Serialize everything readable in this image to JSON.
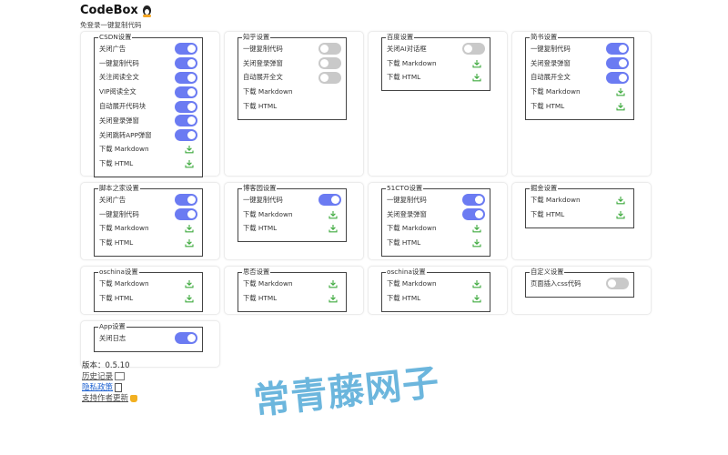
{
  "header": {
    "title": "CodeBox",
    "subtitle": "免登录一键复制代码"
  },
  "cards": [
    {
      "legend": "CSDN设置",
      "rows": [
        {
          "label": "关闭广告",
          "type": "toggle",
          "on": true
        },
        {
          "label": "一键复制代码",
          "type": "toggle",
          "on": true
        },
        {
          "label": "关注阅读全文",
          "type": "toggle",
          "on": true
        },
        {
          "label": "VIP阅读全文",
          "type": "toggle",
          "on": true
        },
        {
          "label": "自动展开代码块",
          "type": "toggle",
          "on": true
        },
        {
          "label": "关闭登录弹窗",
          "type": "toggle",
          "on": true
        },
        {
          "label": "关闭跳转APP弹窗",
          "type": "toggle",
          "on": true
        },
        {
          "label": "下载 Markdown",
          "type": "download"
        },
        {
          "label": "下载 HTML",
          "type": "download"
        }
      ]
    },
    {
      "legend": "知乎设置",
      "rows": [
        {
          "label": "一键复制代码",
          "type": "toggle",
          "on": false
        },
        {
          "label": "关闭登录弹窗",
          "type": "toggle",
          "on": false
        },
        {
          "label": "自动展开全文",
          "type": "toggle",
          "on": false
        },
        {
          "label": "下载 Markdown",
          "type": "text"
        },
        {
          "label": "下载 HTML",
          "type": "text"
        }
      ]
    },
    {
      "legend": "百度设置",
      "rows": [
        {
          "label": "关闭AI对话框",
          "type": "toggle",
          "on": false
        },
        {
          "label": "下载 Markdown",
          "type": "download"
        },
        {
          "label": "下载 HTML",
          "type": "download"
        }
      ]
    },
    {
      "legend": "简书设置",
      "rows": [
        {
          "label": "一键复制代码",
          "type": "toggle",
          "on": true
        },
        {
          "label": "关闭登录弹窗",
          "type": "toggle",
          "on": true
        },
        {
          "label": "自动展开全文",
          "type": "toggle",
          "on": true
        },
        {
          "label": "下载 Markdown",
          "type": "download"
        },
        {
          "label": "下载 HTML",
          "type": "download"
        }
      ]
    },
    {
      "legend": "脚本之家设置",
      "rows": [
        {
          "label": "关闭广告",
          "type": "toggle",
          "on": true
        },
        {
          "label": "一键复制代码",
          "type": "toggle",
          "on": true
        },
        {
          "label": "下载 Markdown",
          "type": "download"
        },
        {
          "label": "下载 HTML",
          "type": "download"
        }
      ]
    },
    {
      "legend": "博客园设置",
      "rows": [
        {
          "label": "一键复制代码",
          "type": "toggle",
          "on": true
        },
        {
          "label": "下载 Markdown",
          "type": "download"
        },
        {
          "label": "下载 HTML",
          "type": "download"
        }
      ]
    },
    {
      "legend": "51CTO设置",
      "rows": [
        {
          "label": "一键复制代码",
          "type": "toggle",
          "on": true
        },
        {
          "label": "关闭登录弹窗",
          "type": "toggle",
          "on": true
        },
        {
          "label": "下载 Markdown",
          "type": "download"
        },
        {
          "label": "下载 HTML",
          "type": "download"
        }
      ]
    },
    {
      "legend": "掘金设置",
      "rows": [
        {
          "label": "下载 Markdown",
          "type": "download"
        },
        {
          "label": "下载 HTML",
          "type": "download"
        }
      ]
    },
    {
      "legend": "oschina设置",
      "rows": [
        {
          "label": "下载 Markdown",
          "type": "download"
        },
        {
          "label": "下载 HTML",
          "type": "download"
        }
      ]
    },
    {
      "legend": "思否设置",
      "rows": [
        {
          "label": "下载 Markdown",
          "type": "download"
        },
        {
          "label": "下载 HTML",
          "type": "download"
        }
      ]
    },
    {
      "legend": "oschina设置",
      "rows": [
        {
          "label": "下载 Markdown",
          "type": "download"
        },
        {
          "label": "下载 HTML",
          "type": "download"
        }
      ]
    },
    {
      "legend": "自定义设置",
      "rows": [
        {
          "label": "页面插入css代码",
          "type": "toggle",
          "on": false
        }
      ]
    },
    {
      "legend": "App设置",
      "rows": [
        {
          "label": "关闭日志",
          "type": "toggle",
          "on": true
        }
      ]
    }
  ],
  "footer": {
    "version": "版本：0.5.10",
    "history": "历史记录",
    "privacy": "隐私政策",
    "support": "支持作者更新"
  },
  "watermark": "常青藤网子",
  "colors": {
    "toggle_on": "#6b7bf2",
    "toggle_off": "#c9c9c9",
    "download_icon": "#3eaa3e"
  },
  "icons": {
    "download": "download-icon",
    "title": "penguin-icon"
  }
}
